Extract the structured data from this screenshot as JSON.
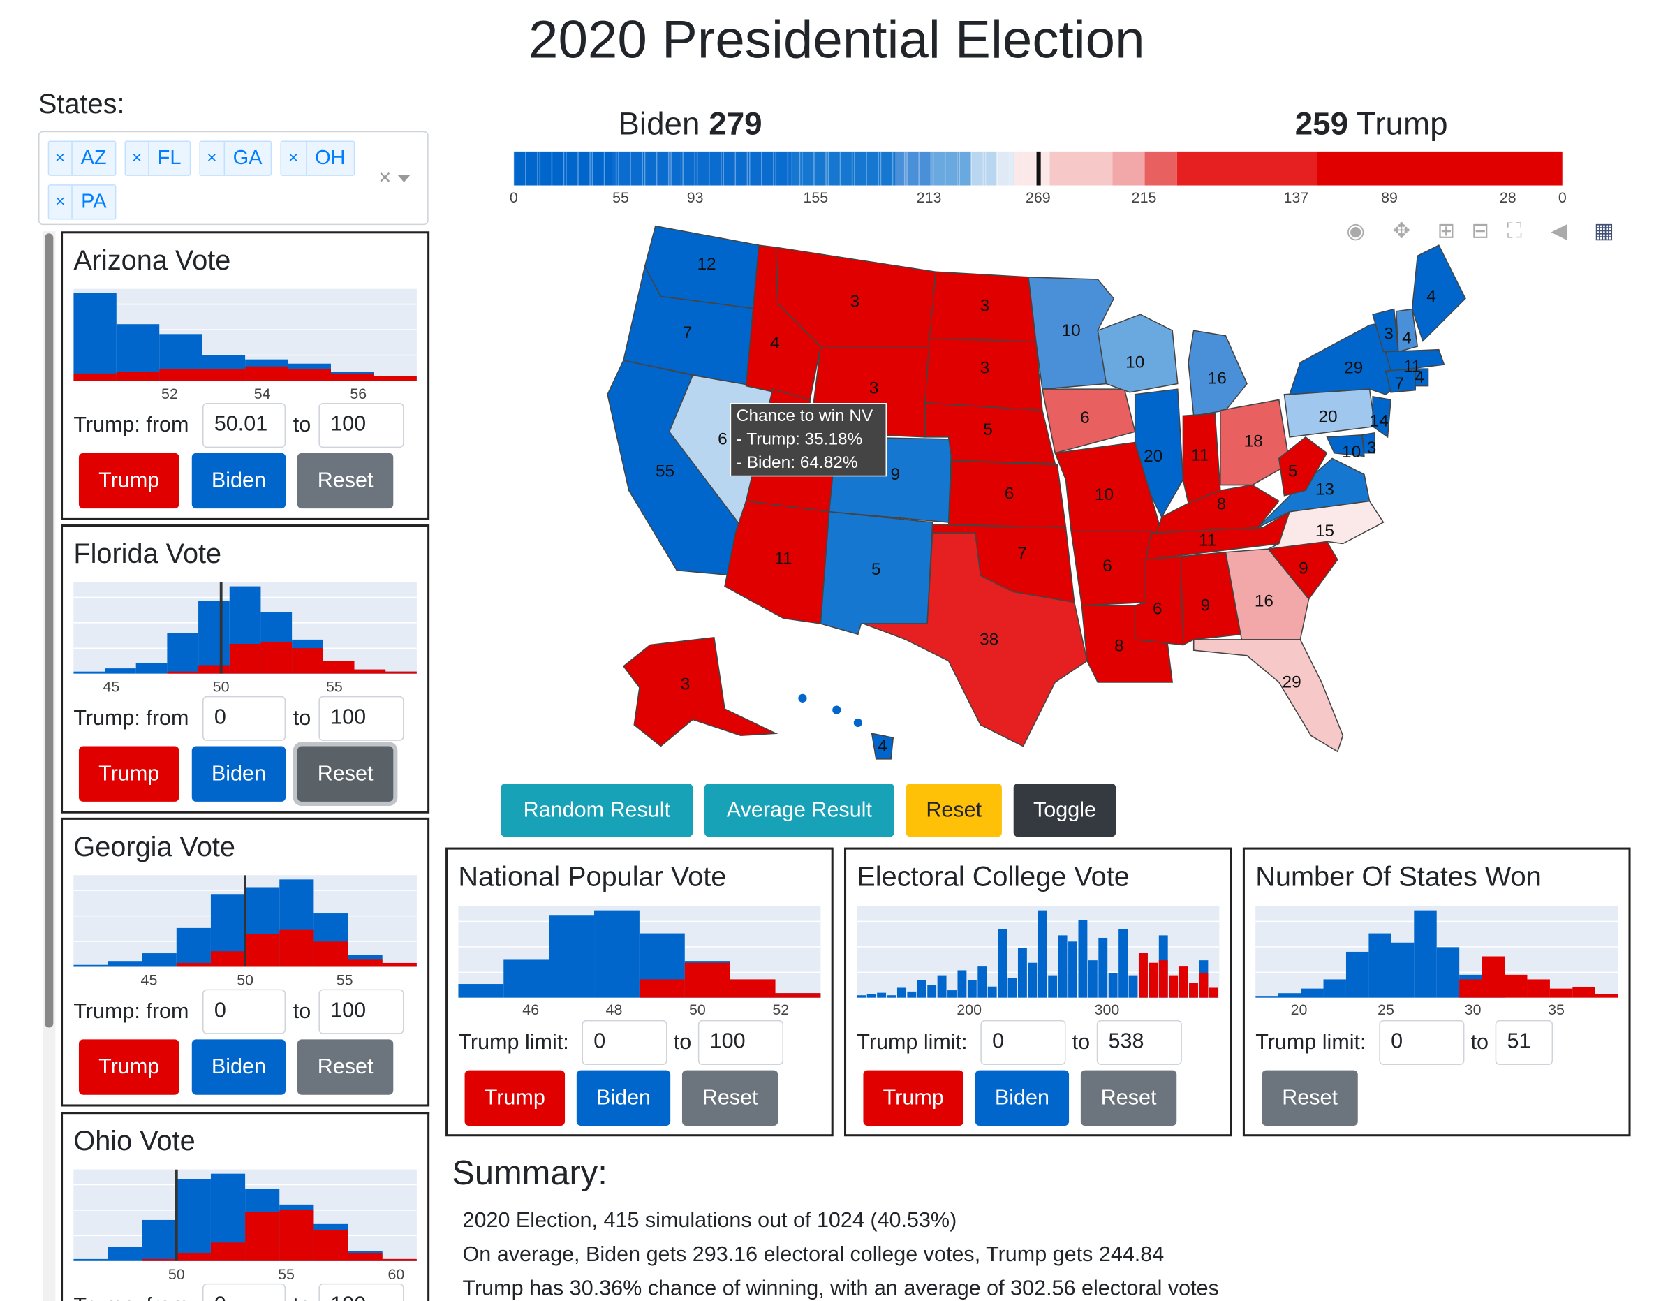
{
  "page_title": "2020 Presidential Election",
  "states_label": "States:",
  "selected_states": [
    "AZ",
    "FL",
    "GA",
    "OH",
    "PA"
  ],
  "ec_bar": {
    "biden_name": "Biden",
    "biden_total": "279",
    "trump_total": "259",
    "trump_name": "Trump",
    "ticks": [
      "0",
      "55",
      "93",
      "155",
      "213",
      "269",
      "215",
      "137",
      "89",
      "28",
      "0"
    ]
  },
  "modebar": [
    "camera-icon",
    "pan-icon",
    "zoom-in-icon",
    "zoom-out-icon",
    "autoscale-icon",
    "reset-axes-icon",
    "plotly-logo-icon"
  ],
  "tooltip": {
    "title": "Chance to win NV",
    "trump": "- Trump: 35.18%",
    "biden": "- Biden: 64.82%"
  },
  "action_buttons": {
    "random": "Random Result",
    "average": "Average Result",
    "reset": "Reset",
    "toggle": "Toggle"
  },
  "state_cards": [
    {
      "title": "Arizona Vote",
      "ticks": [
        "52",
        "54",
        "56"
      ],
      "from_label": "Trump: from",
      "from": "50.01",
      "to_label": "to",
      "to": "100",
      "trump": "Trump",
      "biden": "Biden",
      "reset": "Reset"
    },
    {
      "title": "Florida Vote",
      "ticks": [
        "45",
        "50",
        "55"
      ],
      "from_label": "Trump: from",
      "from": "0",
      "to_label": "to",
      "to": "100",
      "trump": "Trump",
      "biden": "Biden",
      "reset": "Reset"
    },
    {
      "title": "Georgia Vote",
      "ticks": [
        "45",
        "50",
        "55"
      ],
      "from_label": "Trump: from",
      "from": "0",
      "to_label": "to",
      "to": "100",
      "trump": "Trump",
      "biden": "Biden",
      "reset": "Reset"
    },
    {
      "title": "Ohio Vote",
      "ticks": [
        "50",
        "55",
        "60"
      ],
      "from_label": "Trump: from",
      "from": "0",
      "to_label": "to",
      "to": "100"
    }
  ],
  "national_cards": [
    {
      "title": "National Popular Vote",
      "ticks": [
        "46",
        "48",
        "50",
        "52"
      ],
      "limit_label": "Trump limit:",
      "from": "0",
      "to_label": "to",
      "to": "100",
      "trump": "Trump",
      "biden": "Biden",
      "reset": "Reset"
    },
    {
      "title": "Electoral College Vote",
      "ticks": [
        "200",
        "300"
      ],
      "limit_label": "Trump limit:",
      "from": "0",
      "to_label": "to",
      "to": "538",
      "trump": "Trump",
      "biden": "Biden",
      "reset": "Reset"
    },
    {
      "title": "Number Of States Won",
      "ticks": [
        "20",
        "25",
        "30",
        "35"
      ],
      "limit_label": "Trump limit:",
      "from": "0",
      "to_label": "to",
      "to": "51",
      "reset": "Reset"
    }
  ],
  "summary": {
    "heading": "Summary:",
    "lines": [
      "2020 Election, 415 simulations out of 1024 (40.53%)",
      "On average, Biden gets 293.16 electoral college votes, Trump gets 244.84",
      "Trump has 30.36% chance of winning, with an average of 302.56 electoral votes"
    ]
  },
  "map_labels": {
    "WA": "12",
    "OR": "7",
    "CA": "55",
    "NV": "6",
    "ID": "4",
    "MT": "3",
    "WY": "3",
    "UT": "6",
    "AZ": "11",
    "CO": "9",
    "NM": "5",
    "ND": "3",
    "SD": "3",
    "NE": "5",
    "KS": "6",
    "OK": "7",
    "TX": "38",
    "MN": "10",
    "IA": "6",
    "MO": "10",
    "AR": "6",
    "LA": "8",
    "WI": "10",
    "IL": "20",
    "MI": "16",
    "IN": "11",
    "KY": "8",
    "TN": "11",
    "MS": "6",
    "AL": "9",
    "GA": "16",
    "FL": "29",
    "OH": "18",
    "WV": "5",
    "VA": "13",
    "NC": "15",
    "SC": "9",
    "PA": "20",
    "NY": "29",
    "ME": "4",
    "VT": "3",
    "NH": "4",
    "MA": "11",
    "RI": "4",
    "CT": "7",
    "NJ": "14",
    "DE": "3",
    "MD": "10",
    "AK": "3",
    "HI": "4"
  },
  "colors": {
    "trump": "#e00000",
    "biden": "#0066cc",
    "reset": "#6c757d",
    "teal": "#17a2b8",
    "yellow": "#ffc107",
    "dark": "#343a40",
    "plot_bg": "#e5ecf6"
  },
  "chart_data": [
    {
      "type": "bar",
      "name": "Arizona Vote",
      "xlim": [
        50,
        57
      ],
      "biden": [
        62,
        40,
        33,
        18,
        15,
        12,
        6,
        3
      ],
      "trump": [
        5,
        6,
        8,
        8,
        10,
        8,
        5,
        3
      ]
    },
    {
      "type": "bar",
      "name": "Florida Vote",
      "xlim": [
        41,
        58
      ],
      "biden": [
        2,
        5,
        10,
        38,
        68,
        82,
        58,
        32,
        12,
        4,
        2
      ],
      "trump": [
        0,
        0,
        0,
        2,
        8,
        28,
        30,
        24,
        12,
        4,
        2
      ]
    },
    {
      "type": "bar",
      "name": "Georgia Vote",
      "xlim": [
        41,
        58
      ],
      "biden": [
        2,
        6,
        14,
        40,
        75,
        82,
        90,
        55,
        12,
        4
      ],
      "trump": [
        0,
        0,
        0,
        4,
        16,
        34,
        38,
        26,
        8,
        4
      ]
    },
    {
      "type": "bar",
      "name": "Ohio Vote",
      "xlim": [
        46,
        61
      ],
      "biden": [
        2,
        14,
        40,
        80,
        85,
        70,
        55,
        36,
        10,
        2
      ],
      "trump": [
        0,
        0,
        2,
        8,
        18,
        48,
        50,
        30,
        8,
        2
      ]
    },
    {
      "type": "bar",
      "name": "National Popular Vote",
      "xlim": [
        45,
        53
      ],
      "biden": [
        15,
        42,
        90,
        95,
        70,
        40,
        20,
        5
      ],
      "trump": [
        0,
        0,
        0,
        0,
        20,
        38,
        20,
        5
      ]
    },
    {
      "type": "bar",
      "name": "Electoral College Vote",
      "xlim": [
        130,
        400
      ],
      "biden": [
        2,
        3,
        4,
        2,
        8,
        5,
        14,
        10,
        18,
        6,
        22,
        14,
        25,
        9,
        55,
        16,
        40,
        28,
        70,
        18,
        50,
        45,
        62,
        30,
        48,
        20,
        55,
        18,
        36,
        10,
        50,
        12,
        22,
        8,
        30,
        6
      ],
      "trump": [
        0,
        0,
        0,
        0,
        0,
        0,
        0,
        0,
        0,
        0,
        0,
        0,
        0,
        0,
        0,
        0,
        0,
        0,
        0,
        0,
        0,
        0,
        0,
        0,
        0,
        0,
        0,
        0,
        36,
        28,
        30,
        18,
        25,
        12,
        20,
        8
      ]
    },
    {
      "type": "bar",
      "name": "Number Of States Won",
      "xlim": [
        18,
        39
      ],
      "biden": [
        2,
        5,
        10,
        20,
        50,
        70,
        60,
        95,
        55,
        25,
        5,
        0,
        0,
        0,
        0,
        0
      ],
      "trump": [
        0,
        0,
        0,
        0,
        0,
        0,
        0,
        0,
        0,
        20,
        45,
        25,
        20,
        10,
        12,
        4
      ]
    }
  ]
}
